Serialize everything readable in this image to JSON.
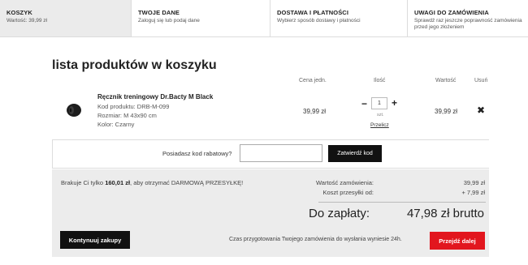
{
  "steps": [
    {
      "title": "KOSZYK",
      "desc": "Wartość: 39,99 zł"
    },
    {
      "title": "TWOJE DANE",
      "desc": "Zaloguj się lub podaj dane"
    },
    {
      "title": "DOSTAWA I PŁATNOŚCI",
      "desc": "Wybierz sposób dostawy i płatności"
    },
    {
      "title": "UWAGI DO ZAMÓWIENIA",
      "desc": "Sprawdź raz jeszcze poprawność zamówienia przed jego złożeniem"
    }
  ],
  "cart": {
    "title": "lista produktów w koszyku",
    "headers": {
      "price": "Cena jedn.",
      "qty": "Ilość",
      "value": "Wartość",
      "remove": "Usuń"
    }
  },
  "product": {
    "name": "Ręcznik treningowy Dr.Bacty M Black",
    "code": "Kod produktu: DRB-M-099",
    "size": "Rozmiar: M 43x90 cm",
    "color": "Kolor: Czarny",
    "price": "39,99 zł",
    "quantity": "1",
    "unit": "szt.",
    "recalc": "Przelicz",
    "value": "39,99 zł",
    "minus": "−",
    "plus": "+",
    "remove": "✖"
  },
  "coupon": {
    "label": "Posiadasz kod rabatowy?",
    "input_value": "",
    "button": "Zatwierdź kod"
  },
  "summary": {
    "free_ship_pre": "Brakuje Ci tylko ",
    "free_ship_amount": "160,01 zł",
    "free_ship_post": ", aby otrzymać DARMOWĄ PRZESYŁKĘ!",
    "order_value_label": "Wartość zamówienia:",
    "order_value": "39,99 zł",
    "shipping_label": "Koszt przesyłki od:",
    "shipping": "+ 7,99 zł",
    "pay_label": "Do zapłaty:",
    "pay_value": "47,98 zł brutto",
    "continue": "Kontynuuj zakupy",
    "prep_time": "Czas przygotowania Twojego zamówienia do wysłania wyniesie 24h.",
    "next": "Przejdź dalej"
  },
  "colors": {
    "accent": "#e2161e",
    "dark_button": "#111111",
    "active_step": "#ebebeb"
  }
}
